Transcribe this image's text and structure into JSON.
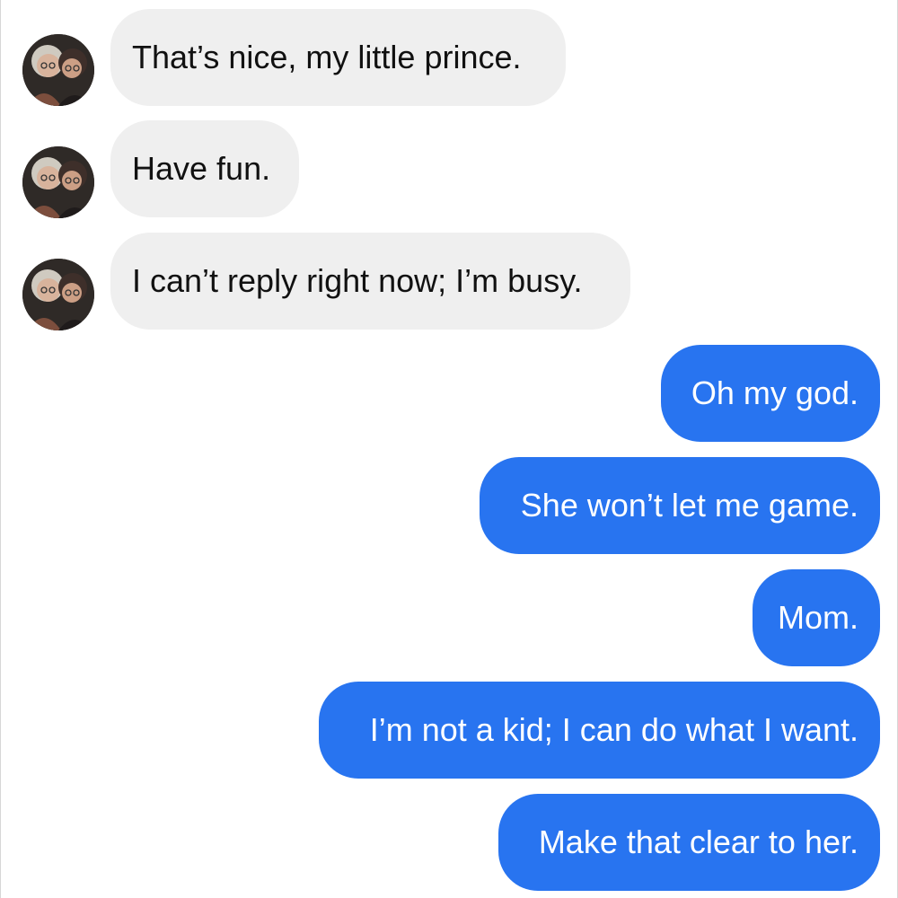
{
  "conversation": {
    "messages": [
      {
        "sender": "contact",
        "text": "That’s nice, my little prince."
      },
      {
        "sender": "contact",
        "text": "Have fun."
      },
      {
        "sender": "contact",
        "text": "I can’t reply right now; I’m busy."
      },
      {
        "sender": "me",
        "text": "Oh my god."
      },
      {
        "sender": "me",
        "text": "She won’t let me game."
      },
      {
        "sender": "me",
        "text": "Mom."
      },
      {
        "sender": "me",
        "text": "I’m not a kid; I can do what I want."
      },
      {
        "sender": "me",
        "text": "Make that clear to her."
      }
    ],
    "avatar_icon": "contact-photo-avatar-icon"
  },
  "colors": {
    "incoming_bubble": "#efefef",
    "outgoing_bubble": "#2874f0",
    "incoming_text": "#111111",
    "outgoing_text": "#ffffff"
  }
}
